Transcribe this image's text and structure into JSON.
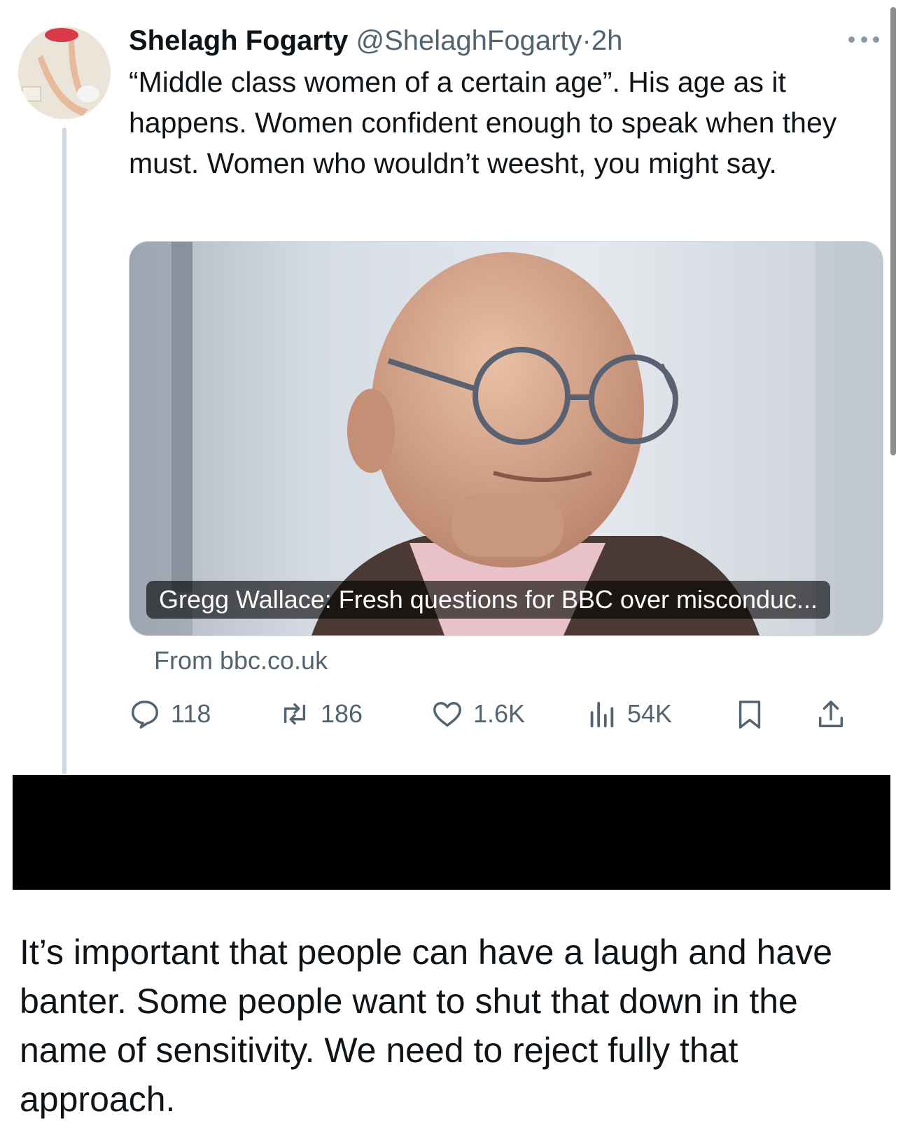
{
  "tweet": {
    "author_name": "Shelagh Fogarty",
    "author_handle": "@ShelaghFogarty",
    "separator": "·",
    "timestamp": "2h",
    "text": "“Middle class women of a certain age”. His age as it happens. Women confident enough to speak when they must. Women who wouldn’t weesht, you might say.",
    "avatar_icon": "avatar-illustration"
  },
  "link_card": {
    "caption": "Gregg Wallace: Fresh questions for BBC over misconduc...",
    "source": "From bbc.co.uk",
    "image_icon": "man-with-glasses-photo"
  },
  "actions": {
    "replies": "118",
    "reposts": "186",
    "likes": "1.6K",
    "views": "54K"
  },
  "reply_text": "It’s important that people can have a laugh and have banter. Some people want to shut that down in the name of sensitivity. We need to reject fully that approach.",
  "colors": {
    "text_primary": "#0f1419",
    "text_secondary": "#536471",
    "thread_line": "#cfd9de",
    "redaction": "#000000"
  }
}
